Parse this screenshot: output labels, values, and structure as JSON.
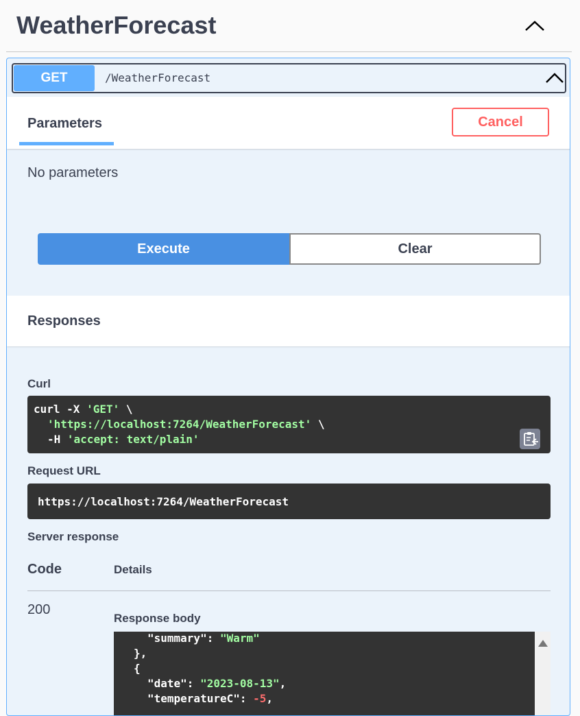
{
  "header": {
    "title": "WeatherForecast"
  },
  "operation": {
    "method": "GET",
    "path": "/WeatherForecast"
  },
  "parameters": {
    "tab_label": "Parameters",
    "cancel_label": "Cancel",
    "empty_text": "No parameters"
  },
  "actions": {
    "execute_label": "Execute",
    "clear_label": "Clear"
  },
  "responses": {
    "title": "Responses",
    "curl_label": "Curl",
    "curl": {
      "line1_cmd": "curl -X ",
      "line1_str": "'GET'",
      "line1_end": " \\",
      "line2_str": "'https://localhost:7264/WeatherForecast'",
      "line2_end": " \\",
      "line3_cmd": "-H ",
      "line3_str": "'accept: text/plain'"
    },
    "request_url_label": "Request URL",
    "request_url": "https://localhost:7264/WeatherForecast",
    "server_response_label": "Server response",
    "col_code": "Code",
    "col_details": "Details",
    "code": "200",
    "response_body_label": "Response body",
    "body": {
      "summary_key": "\"summary\"",
      "summary_val": "\"Warm\"",
      "close_obj": "},",
      "open_obj": "{",
      "date_key": "\"date\"",
      "date_val": "\"2023-08-13\"",
      "temp_key": "\"temperatureC\"",
      "temp_val": "-5"
    }
  },
  "colors": {
    "get_blue": "#61affe",
    "execute_blue": "#4990e2",
    "cancel_red": "#ff6060",
    "code_bg": "#333333",
    "string_green": "#a2fca2",
    "number_red": "#fc6d6d"
  }
}
